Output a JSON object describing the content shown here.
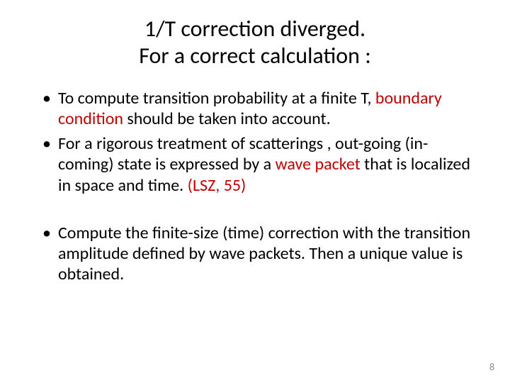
{
  "title": {
    "line1": "1/T correction diverged.",
    "line2": "For a correct calculation :"
  },
  "bullets": {
    "b1_a": "To compute transition probability at a finite T, ",
    "b1_red": "boundary condition",
    "b1_b": " should be taken into account.",
    "b2_a": "For a rigorous treatment of scatterings , out-going (in-coming) state is expressed by a ",
    "b2_red1": "wave packet",
    "b2_b": " that is localized in space and time. ",
    "b2_red2": "(LSZ, 55)",
    "b3": "Compute the finite-size (time) correction with the transition amplitude defined by wave packets. Then a unique value is obtained."
  },
  "page_number": "8"
}
